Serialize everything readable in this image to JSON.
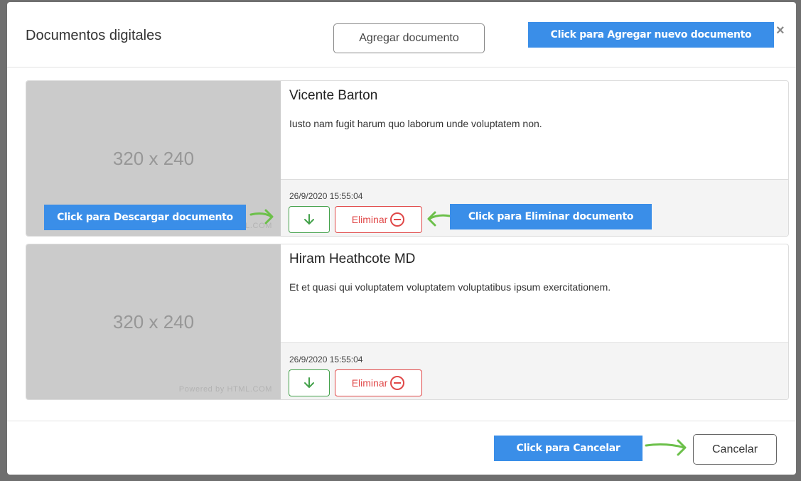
{
  "header": {
    "title": "Documentos digitales",
    "add_button_label": "Agregar documento",
    "close_label": "×"
  },
  "callouts": {
    "add": "Click para Agregar nuevo documento",
    "download": "Click para Descargar documento",
    "delete": "Click para Eliminar documento",
    "cancel": "Click para Cancelar"
  },
  "documents": [
    {
      "thumb_size": "320 x 240",
      "thumb_powered": "Powered by HTML.COM",
      "name": "Vicente Barton",
      "description": "Iusto nam fugit harum quo laborum unde voluptatem non.",
      "date": "26/9/2020 15:55:04",
      "delete_label": "Eliminar"
    },
    {
      "thumb_size": "320 x 240",
      "thumb_powered": "Powered by HTML.COM",
      "name": "Hiram Heathcote MD",
      "description": "Et et quasi qui voluptatem voluptatem voluptatibus ipsum exercitationem.",
      "date": "26/9/2020 15:55:04",
      "delete_label": "Eliminar"
    }
  ],
  "footer": {
    "cancel_label": "Cancelar"
  },
  "colors": {
    "callout": "#3a8ee8",
    "success": "#43a14a",
    "danger": "#e04848",
    "arrow": "#6cc04a"
  },
  "icons": {
    "download": "arrow-down-icon",
    "delete": "minus-circle-icon",
    "close": "close-icon",
    "pointer": "curved-arrow-icon"
  }
}
